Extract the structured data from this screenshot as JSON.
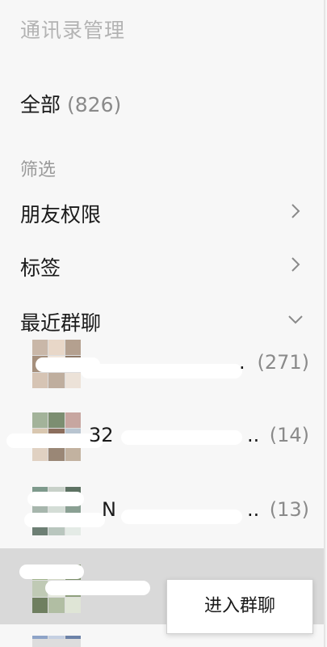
{
  "panel": {
    "title": "通讯录管理",
    "all": {
      "label": "全部",
      "count": "(826)"
    },
    "filter_label": "筛选",
    "nav": [
      {
        "label": "朋友权限",
        "chevron": "chevron-right-icon"
      },
      {
        "label": "标签",
        "chevron": "chevron-right-icon"
      },
      {
        "label": "最近群聊",
        "chevron": "chevron-down-icon"
      }
    ]
  },
  "groups": [
    {
      "name": "",
      "count": "(271)",
      "name_tail": "."
    },
    {
      "name": "32",
      "count": "(14)",
      "name_tail": ".."
    },
    {
      "name": "N",
      "count": "(13)",
      "name_tail": ".."
    },
    {
      "name": "",
      "count": "",
      "name_tail": ""
    }
  ],
  "context_menu": {
    "enter_group": "进入群聊"
  },
  "colors": {
    "background": "#f7f7f7",
    "selected": "#d9d9d9",
    "muted_text": "#8a8a8a"
  }
}
